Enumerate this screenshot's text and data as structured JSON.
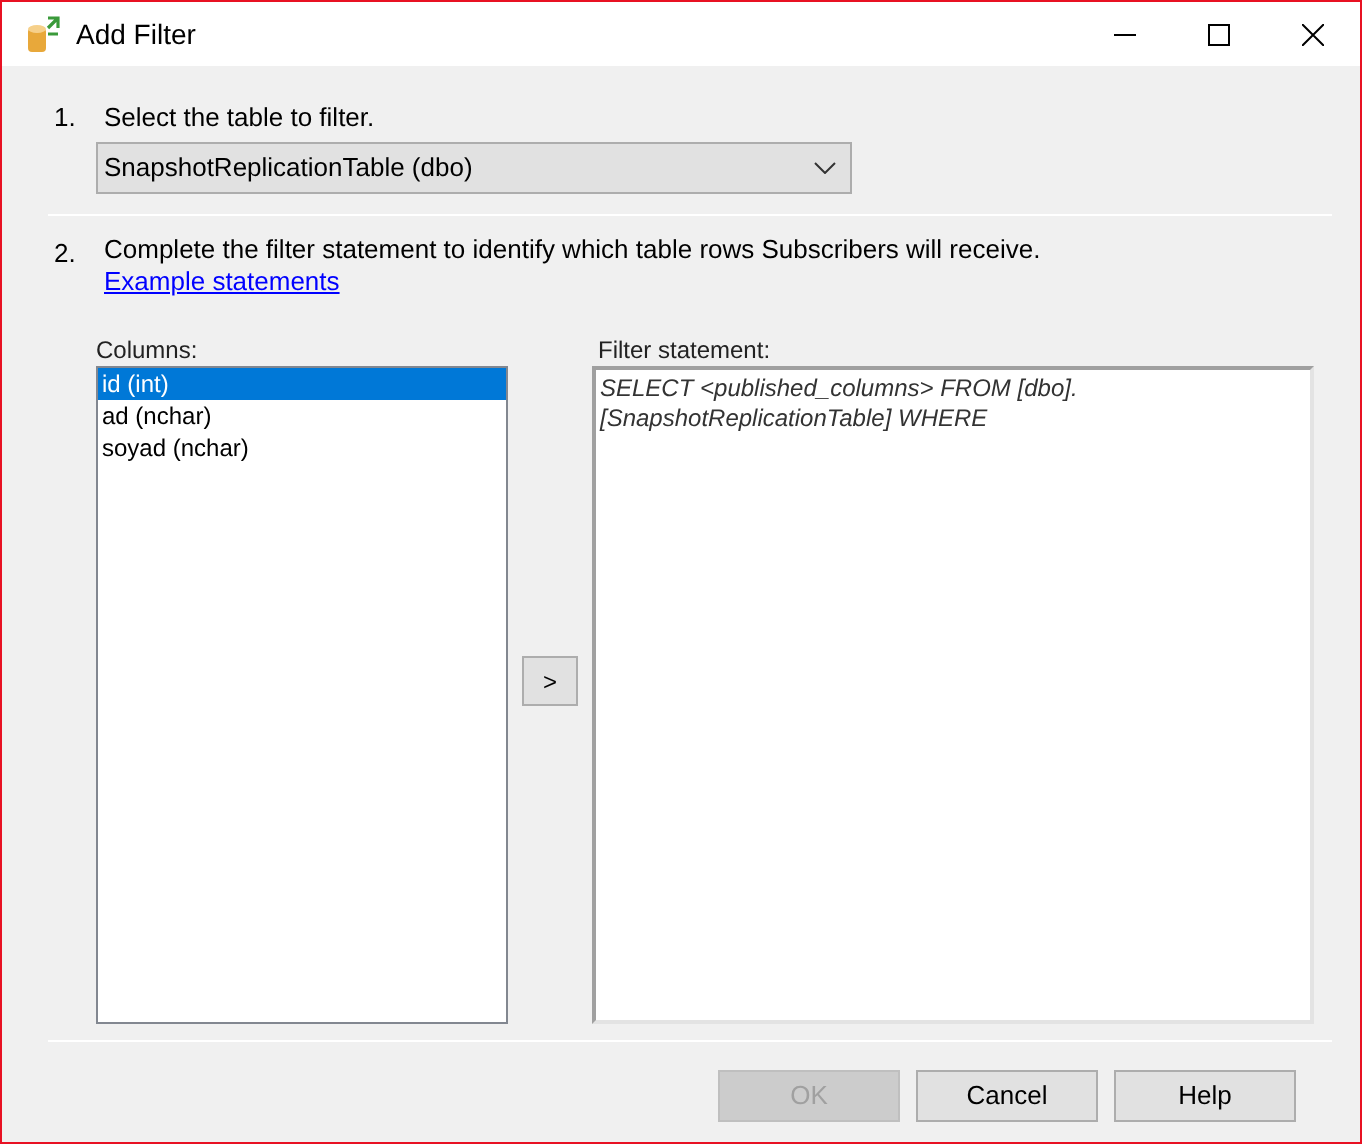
{
  "window": {
    "title": "Add Filter"
  },
  "step_1": {
    "number": "1.",
    "label": "Select the table to filter.",
    "table": "SnapshotReplicationTable (dbo)"
  },
  "step_2": {
    "number": "2.",
    "text": "Complete the filter statement to identify which table rows Subscribers will receive.",
    "link": "Example statements"
  },
  "columns": {
    "label": "Columns:",
    "items": [
      {
        "text": "id (int)",
        "selected": true
      },
      {
        "text": "ad (nchar)",
        "selected": false
      },
      {
        "text": "soyad (nchar)",
        "selected": false
      }
    ]
  },
  "add_button": ">",
  "filter": {
    "label": "Filter statement:",
    "text": "SELECT <published_columns> FROM [dbo].[SnapshotReplicationTable] WHERE"
  },
  "buttons": [
    {
      "label": "OK",
      "disabled": true
    },
    {
      "label": "Cancel",
      "disabled": false
    },
    {
      "label": "Help",
      "disabled": false
    }
  ]
}
